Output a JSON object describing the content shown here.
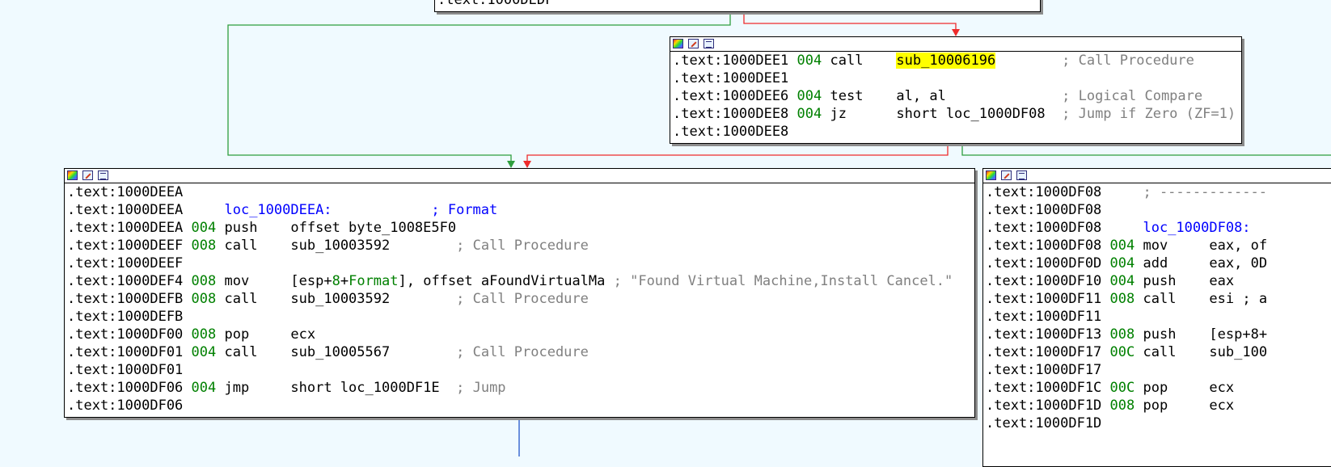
{
  "top_block": {
    "line": ".text:1000DEDF"
  },
  "block_a": {
    "lines": [
      {
        "addr": ".text:1000DEE1",
        "sp": "004",
        "mn": "call",
        "op": "sub_10006196",
        "op_hl": true,
        "cm": "; Call Procedure"
      },
      {
        "addr": ".text:1000DEE1",
        "sp": "",
        "mn": "",
        "op": "",
        "op_hl": false,
        "cm": ""
      },
      {
        "addr": ".text:1000DEE6",
        "sp": "004",
        "mn": "test",
        "op": "al, al",
        "op_hl": false,
        "cm": "; Logical Compare"
      },
      {
        "addr": ".text:1000DEE8",
        "sp": "004",
        "mn": "jz",
        "op": "short loc_1000DF08",
        "op_hl": false,
        "cm": "; Jump if Zero (ZF=1)"
      },
      {
        "addr": ".text:1000DEE8",
        "sp": "",
        "mn": "",
        "op": "",
        "op_hl": false,
        "cm": ""
      }
    ]
  },
  "block_b": {
    "lines": [
      {
        "addr": ".text:1000DEEA",
        "raw": ""
      },
      {
        "addr": ".text:1000DEEA",
        "label": "loc_1000DEEA:",
        "cm_blue": "; Format"
      },
      {
        "addr": ".text:1000DEEA",
        "sp": "004",
        "mn": "push",
        "op": "offset byte_1008E5F0",
        "cm": ""
      },
      {
        "addr": ".text:1000DEEF",
        "sp": "008",
        "mn": "call",
        "op": "sub_10003592",
        "cm": "; Call Procedure"
      },
      {
        "addr": ".text:1000DEEF",
        "raw": ""
      },
      {
        "addr": ".text:1000DEF4",
        "sp": "008",
        "mn": "mov",
        "op_pre": "[esp+",
        "op_num": "8",
        "op_plus": "+",
        "op_fmt": "Format",
        "op_post": "], offset aFoundVirtualMa",
        "cm": " ; \"Found Virtual Machine,Install Cancel.\""
      },
      {
        "addr": ".text:1000DEFB",
        "sp": "008",
        "mn": "call",
        "op": "sub_10003592",
        "cm": "; Call Procedure"
      },
      {
        "addr": ".text:1000DEFB",
        "raw": ""
      },
      {
        "addr": ".text:1000DF00",
        "sp": "008",
        "mn": "pop",
        "op": "ecx",
        "cm": ""
      },
      {
        "addr": ".text:1000DF01",
        "sp": "004",
        "mn": "call",
        "op": "sub_10005567",
        "cm": "; Call Procedure"
      },
      {
        "addr": ".text:1000DF01",
        "raw": ""
      },
      {
        "addr": ".text:1000DF06",
        "sp": "004",
        "mn": "jmp",
        "op": "short loc_1000DF1E",
        "cm": "; Jump"
      },
      {
        "addr": ".text:1000DF06",
        "raw": ""
      }
    ]
  },
  "block_c": {
    "lines": [
      {
        "addr": ".text:1000DF08",
        "text": "     ; -------------"
      },
      {
        "addr": ".text:1000DF08",
        "text": ""
      },
      {
        "addr": ".text:1000DF08",
        "label": "loc_1000DF08:"
      },
      {
        "addr": ".text:1000DF08",
        "sp": "004",
        "mn": "mov",
        "op": "eax, of"
      },
      {
        "addr": ".text:1000DF0D",
        "sp": "004",
        "mn": "add",
        "op": "eax, 0D"
      },
      {
        "addr": ".text:1000DF10",
        "sp": "004",
        "mn": "push",
        "op": "eax"
      },
      {
        "addr": ".text:1000DF11",
        "sp": "008",
        "mn": "call",
        "op": "esi ; a"
      },
      {
        "addr": ".text:1000DF11",
        "text": ""
      },
      {
        "addr": ".text:1000DF13",
        "sp": "008",
        "mn": "push",
        "op": "[esp+8+"
      },
      {
        "addr": ".text:1000DF17",
        "sp": "00C",
        "mn": "call",
        "op": "sub_100"
      },
      {
        "addr": ".text:1000DF17",
        "text": ""
      },
      {
        "addr": ".text:1000DF1C",
        "sp": "00C",
        "mn": "pop",
        "op": "ecx"
      },
      {
        "addr": ".text:1000DF1D",
        "sp": "008",
        "mn": "pop",
        "op": "ecx"
      },
      {
        "addr": ".text:1000DF1D",
        "text": ""
      }
    ]
  },
  "colors": {
    "background": "#f0faff",
    "edge_true": "#2e9e3e",
    "edge_false": "#ee2b2b",
    "edge_uncond": "#2356c8",
    "highlight": "#ffff00",
    "stack": "#008000",
    "label": "#0000ff",
    "comment": "#808080"
  },
  "icons": [
    "color-palette-icon",
    "edit-node-icon",
    "graph-view-icon"
  ]
}
